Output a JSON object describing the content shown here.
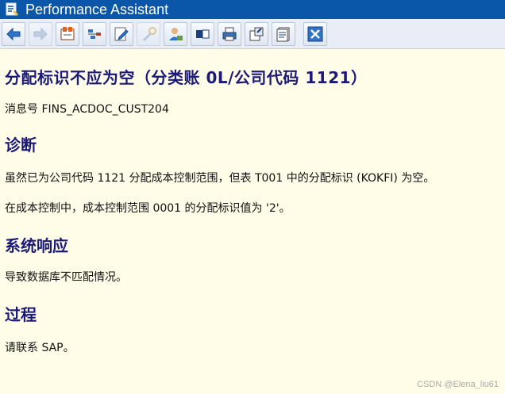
{
  "window": {
    "title": "Performance Assistant"
  },
  "toolbar": {
    "buttons": [
      {
        "icon": "back-arrow-icon"
      },
      {
        "icon": "forward-arrow-icon"
      },
      {
        "icon": "technical-info-icon"
      },
      {
        "icon": "settings-icon"
      },
      {
        "icon": "edit-icon"
      },
      {
        "icon": "wrench-icon"
      },
      {
        "icon": "user-icon"
      },
      {
        "icon": "open-window-icon"
      },
      {
        "icon": "print-icon"
      },
      {
        "icon": "export-icon"
      },
      {
        "icon": "save-document-icon"
      },
      {
        "icon": "close-icon"
      }
    ]
  },
  "message": {
    "title": "分配标识不应为空（分类账  0L/公司代码  1121）",
    "number_line": "消息号  FINS_ACDOC_CUST204",
    "sections": {
      "diagnosis_heading": "诊断",
      "diagnosis_text_1": "虽然已为公司代码  1121 分配成本控制范围，但表  T001 中的分配标识  (KOKFI) 为空。",
      "diagnosis_text_2": "在成本控制中，成本控制范围  0001 的分配标识值为  '2'。",
      "response_heading": "系统响应",
      "response_text": "导致数据库不匹配情况。",
      "procedure_heading": "过程",
      "procedure_text": "请联系  SAP。"
    }
  },
  "watermark": "CSDN @Elena_liu61"
}
